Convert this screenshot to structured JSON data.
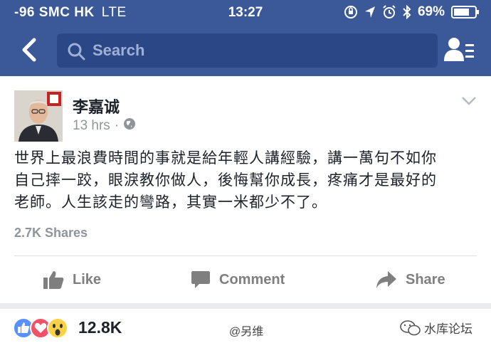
{
  "status_bar": {
    "carrier": "-96 SMC HK",
    "network": "LTE",
    "time": "13:27",
    "battery": "69%"
  },
  "nav": {
    "search_placeholder": "Search"
  },
  "post": {
    "author": "李嘉诚",
    "timestamp": "13 hrs",
    "separator": "·",
    "text_lines": [
      "世界上最浪費時間的事就是給年輕人講經驗，講一萬句不如你",
      "自己摔一跤，眼淚教你做人，後悔幫你成長，疼痛才是最好的",
      "老師。人生該走的彎路，其實一米都少不了。"
    ],
    "shares": "2.7K Shares"
  },
  "actions": {
    "like": "Like",
    "comment": "Comment",
    "share": "Share"
  },
  "reactions": {
    "count": "12.8K"
  },
  "watermarks": {
    "weibo": "@另维",
    "forum": "水库论坛"
  },
  "colors": {
    "facebook_blue": "#3b5998",
    "search_bg": "#2c4785",
    "like_blue": "#5890ff",
    "love_red": "#f25268",
    "wow_yellow": "#fcd145"
  }
}
